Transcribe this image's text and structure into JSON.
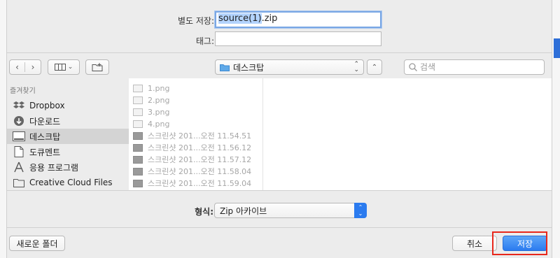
{
  "save_as": {
    "label": "별도 저장:",
    "filename_selected": "source(1)",
    "filename_ext": ".zip"
  },
  "tags": {
    "label": "태그:",
    "value": ""
  },
  "toolbar": {
    "location": "데스크탑",
    "search_placeholder": "검색"
  },
  "sidebar": {
    "header": "즐겨찾기",
    "items": [
      {
        "label": "Dropbox",
        "icon": "dropbox-icon"
      },
      {
        "label": "다운로드",
        "icon": "download-icon"
      },
      {
        "label": "데스크탑",
        "icon": "desktop-icon",
        "active": true
      },
      {
        "label": "도큐멘트",
        "icon": "document-icon"
      },
      {
        "label": "응용 프로그램",
        "icon": "applications-icon"
      },
      {
        "label": "Creative Cloud Files",
        "icon": "folder-icon"
      }
    ]
  },
  "files": [
    {
      "name": "1.png",
      "kind": "png"
    },
    {
      "name": "2.png",
      "kind": "png"
    },
    {
      "name": "3.png",
      "kind": "png"
    },
    {
      "name": "4.png",
      "kind": "png"
    },
    {
      "name": "스크린샷 201...오전 11.54.51",
      "kind": "shot"
    },
    {
      "name": "스크린샷 201...오전 11.56.12",
      "kind": "shot"
    },
    {
      "name": "스크린샷 201...오전 11.57.12",
      "kind": "shot"
    },
    {
      "name": "스크린샷 201...오전 11.58.04",
      "kind": "shot"
    },
    {
      "name": "스크린샷 201...오전 11.59.04",
      "kind": "shot"
    }
  ],
  "format": {
    "label": "형식:",
    "value": "Zip 아카이브"
  },
  "buttons": {
    "new_folder": "새로운 폴더",
    "cancel": "취소",
    "save": "저장"
  },
  "colors": {
    "accent": "#2b7bef",
    "highlight_outline": "#e8281c"
  }
}
